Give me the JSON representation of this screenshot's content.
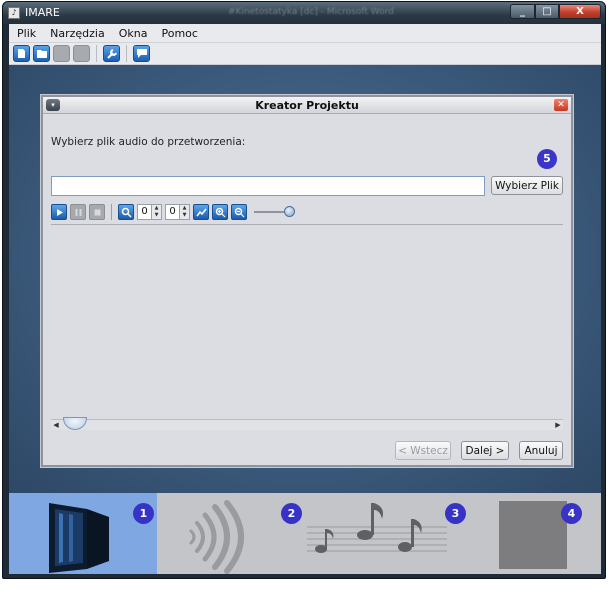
{
  "window": {
    "app_title": "IMARE",
    "background_title": "#Kinetostatyka [dc] - Microsoft Word",
    "buttons": [
      "_",
      "□",
      "X"
    ]
  },
  "menu": [
    "Plik",
    "Narzędzia",
    "Okna",
    "Pomoc"
  ],
  "toolbar": {
    "icons": [
      "new-file-icon",
      "open-folder-icon",
      "disabled-save-icon",
      "disabled-action-icon",
      "wrench-icon",
      "chat-icon"
    ]
  },
  "dialog": {
    "title": "Kreator Projektu",
    "menu_glyph": "▾",
    "close_glyph": "✕",
    "prompt": "Wybierz plik audio do przetworzenia:",
    "step_badge": "5",
    "file_value": "",
    "choose_button": "Wybierz Plik",
    "controls": {
      "spinner1_value": "0",
      "spinner2_value": "0",
      "slider_level": 1.0
    },
    "back_button": "< Wstecz",
    "next_button": "Dalej >",
    "cancel_button": "Anuluj"
  },
  "steps": [
    {
      "number": "1",
      "icon": "tablet-device-icon",
      "active": true
    },
    {
      "number": "2",
      "icon": "sound-waves-icon",
      "active": false
    },
    {
      "number": "3",
      "icon": "music-notes-icon",
      "active": false
    },
    {
      "number": "4",
      "icon": "empty-square-icon",
      "active": false
    }
  ],
  "colors": {
    "accent_badge": "#3733c6",
    "active_step": "#7fa8e2",
    "desktop": "#3f5f82"
  }
}
